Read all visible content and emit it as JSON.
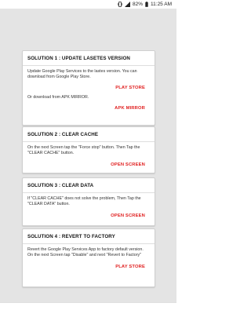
{
  "status_bar": {
    "battery_percent": "82%",
    "time": "11:25 AM",
    "icons": [
      "vibrate-icon",
      "signal-icon",
      "battery-icon"
    ]
  },
  "colors": {
    "action_text": "#e01e1e",
    "background": "#e4e4e4",
    "card": "#ffffff"
  },
  "solutions": [
    {
      "title": "SOLUTION 1 : UPDATE LASETES VERSION",
      "body": "Update Google Play Services to the lastes version. You can download from Google Play Store.",
      "action": "PLAY STORE",
      "body2": "Or download from APK MIRROR.",
      "action2": "APK MIRROR"
    },
    {
      "title": "SOLUTION 2 : CLEAR CACHE",
      "body": "On the next Screen tap the \"Force stop\" button. Then Tap the \"CLEAR CACHE\" button.",
      "action": "OPEN SCREEN"
    },
    {
      "title": "SOLUTION 3 : CLEAR DATA",
      "body": "If \"CLEAR CACHE\" does not solve the problem, Then Tap the \"CLEAR DATA\" button.",
      "action": "OPEN SCREEN"
    },
    {
      "title": "SOLUTION 4 : REVERT TO FACTORY",
      "body": "Revert the Google Play Services App to factory default version. On the next Screen tap \"Disable\" and next \"Revert to Factory\"",
      "action": "PLAY STORE"
    }
  ]
}
